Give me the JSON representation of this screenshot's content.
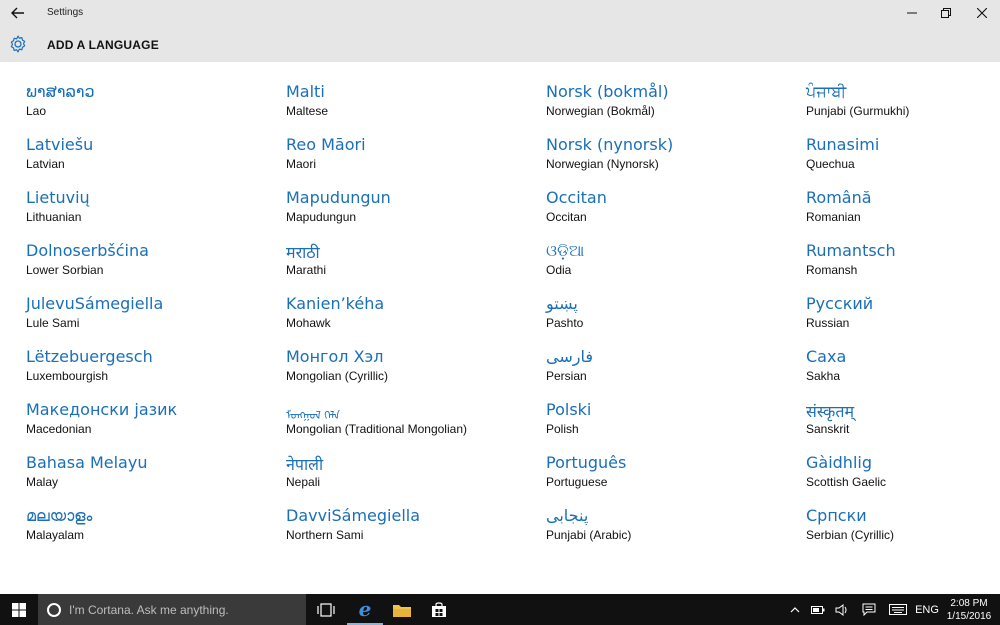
{
  "window": {
    "title": "Settings",
    "back_icon": "back-arrow-icon",
    "minimize_icon": "minimize-icon",
    "maximize_icon": "restore-icon",
    "close_icon": "close-icon"
  },
  "header": {
    "icon": "gear-icon",
    "title": "ADD A LANGUAGE"
  },
  "columns": [
    [
      {
        "native": "ພາສາລາວ",
        "english": "Lao"
      },
      {
        "native": "Latviešu",
        "english": "Latvian"
      },
      {
        "native": "Lietuvių",
        "english": "Lithuanian"
      },
      {
        "native": "Dolnoserbšćina",
        "english": "Lower Sorbian"
      },
      {
        "native": "JulevuSámegiella",
        "english": "Lule Sami"
      },
      {
        "native": "Lëtzebuergesch",
        "english": "Luxembourgish"
      },
      {
        "native": "Македонски јазик",
        "english": "Macedonian"
      },
      {
        "native": "Bahasa Melayu",
        "english": "Malay"
      },
      {
        "native": "മലയാളം",
        "english": "Malayalam"
      }
    ],
    [
      {
        "native": "Malti",
        "english": "Maltese"
      },
      {
        "native": "Reo Māori",
        "english": "Maori"
      },
      {
        "native": "Mapudungun",
        "english": "Mapudungun"
      },
      {
        "native": "मराठी",
        "english": "Marathi"
      },
      {
        "native": "Kanien’kéha",
        "english": "Mohawk"
      },
      {
        "native": "Монгол Хэл",
        "english": "Mongolian (Cyrillic)"
      },
      {
        "native": "ᠮᠣᠩᠭᠣᠯ ᠬᠡᠯᠡ",
        "english": "Mongolian (Traditional Mongolian)"
      },
      {
        "native": "नेपाली",
        "english": "Nepali"
      },
      {
        "native": "DavviSámegiella",
        "english": "Northern Sami"
      }
    ],
    [
      {
        "native": "Norsk (bokmål)",
        "english": "Norwegian (Bokmål)"
      },
      {
        "native": "Norsk (nynorsk)",
        "english": "Norwegian (Nynorsk)"
      },
      {
        "native": "Occitan",
        "english": "Occitan"
      },
      {
        "native": "ଓଡ଼ିଆ",
        "english": "Odia"
      },
      {
        "native": "پښتو",
        "english": "Pashto"
      },
      {
        "native": "فارسی",
        "english": "Persian"
      },
      {
        "native": "Polski",
        "english": "Polish"
      },
      {
        "native": "Português",
        "english": "Portuguese"
      },
      {
        "native": "پنجابی",
        "english": "Punjabi (Arabic)"
      }
    ],
    [
      {
        "native": "ਪੰਜਾਬੀ",
        "english": "Punjabi (Gurmukhi)"
      },
      {
        "native": "Runasimi",
        "english": "Quechua"
      },
      {
        "native": "Română",
        "english": "Romanian"
      },
      {
        "native": "Rumantsch",
        "english": "Romansh"
      },
      {
        "native": "Русский",
        "english": "Russian"
      },
      {
        "native": "Саха",
        "english": "Sakha"
      },
      {
        "native": "संस्कृतम्",
        "english": "Sanskrit"
      },
      {
        "native": "Gàidhlig",
        "english": "Scottish Gaelic"
      },
      {
        "native": "Српски",
        "english": "Serbian (Cyrillic)"
      }
    ]
  ],
  "taskbar": {
    "start_icon": "windows-logo-icon",
    "search_placeholder": "I'm Cortana. Ask me anything.",
    "apps": [
      "task-view-icon",
      "edge-browser-icon",
      "file-explorer-icon",
      "store-icon"
    ],
    "tray": {
      "language": "ENG",
      "time": "2:08 PM",
      "date": "1/15/2016"
    }
  },
  "colors": {
    "accent": "#1a6fb8",
    "chrome": "#e6e6e6",
    "taskbar": "#111111"
  }
}
